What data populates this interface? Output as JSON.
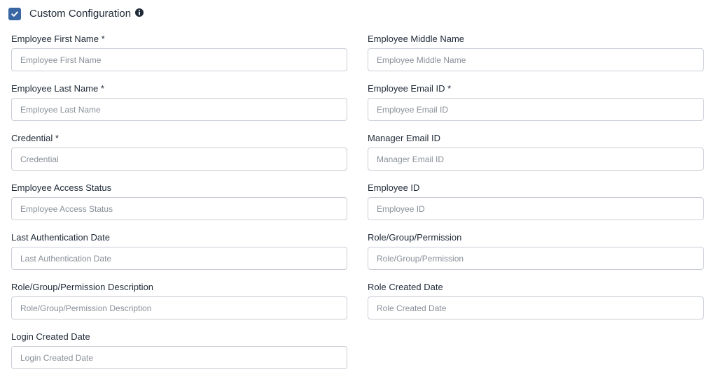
{
  "header": {
    "title": "Custom Configuration",
    "checked": true
  },
  "fields": {
    "first_name": {
      "label": "Employee First Name *",
      "placeholder": "Employee First Name",
      "value": ""
    },
    "middle_name": {
      "label": "Employee Middle Name",
      "placeholder": "Employee Middle Name",
      "value": ""
    },
    "last_name": {
      "label": "Employee Last Name *",
      "placeholder": "Employee Last Name",
      "value": ""
    },
    "email_id": {
      "label": "Employee Email ID *",
      "placeholder": "Employee Email ID",
      "value": ""
    },
    "credential": {
      "label": "Credential *",
      "placeholder": "Credential",
      "value": ""
    },
    "manager_email": {
      "label": "Manager Email ID",
      "placeholder": "Manager Email ID",
      "value": ""
    },
    "access_status": {
      "label": "Employee Access Status",
      "placeholder": "Employee Access Status",
      "value": ""
    },
    "employee_id": {
      "label": "Employee ID",
      "placeholder": "Employee ID",
      "value": ""
    },
    "last_auth_date": {
      "label": "Last Authentication Date",
      "placeholder": "Last Authentication Date",
      "value": ""
    },
    "role_group_permission": {
      "label": "Role/Group/Permission",
      "placeholder": "Role/Group/Permission",
      "value": ""
    },
    "role_group_permission_desc": {
      "label": "Role/Group/Permission Description",
      "placeholder": "Role/Group/Permission Description",
      "value": ""
    },
    "role_created_date": {
      "label": "Role Created Date",
      "placeholder": "Role Created Date",
      "value": ""
    },
    "login_created_date": {
      "label": "Login Created Date",
      "placeholder": "Login Created Date",
      "value": ""
    }
  },
  "icons": {
    "checkbox": "check-icon",
    "info": "info-icon"
  },
  "colors": {
    "checkbox_fill": "#3a67a3",
    "input_border": "#c9ced6",
    "placeholder_text": "#8a9099",
    "label_text": "#1f2a37"
  }
}
